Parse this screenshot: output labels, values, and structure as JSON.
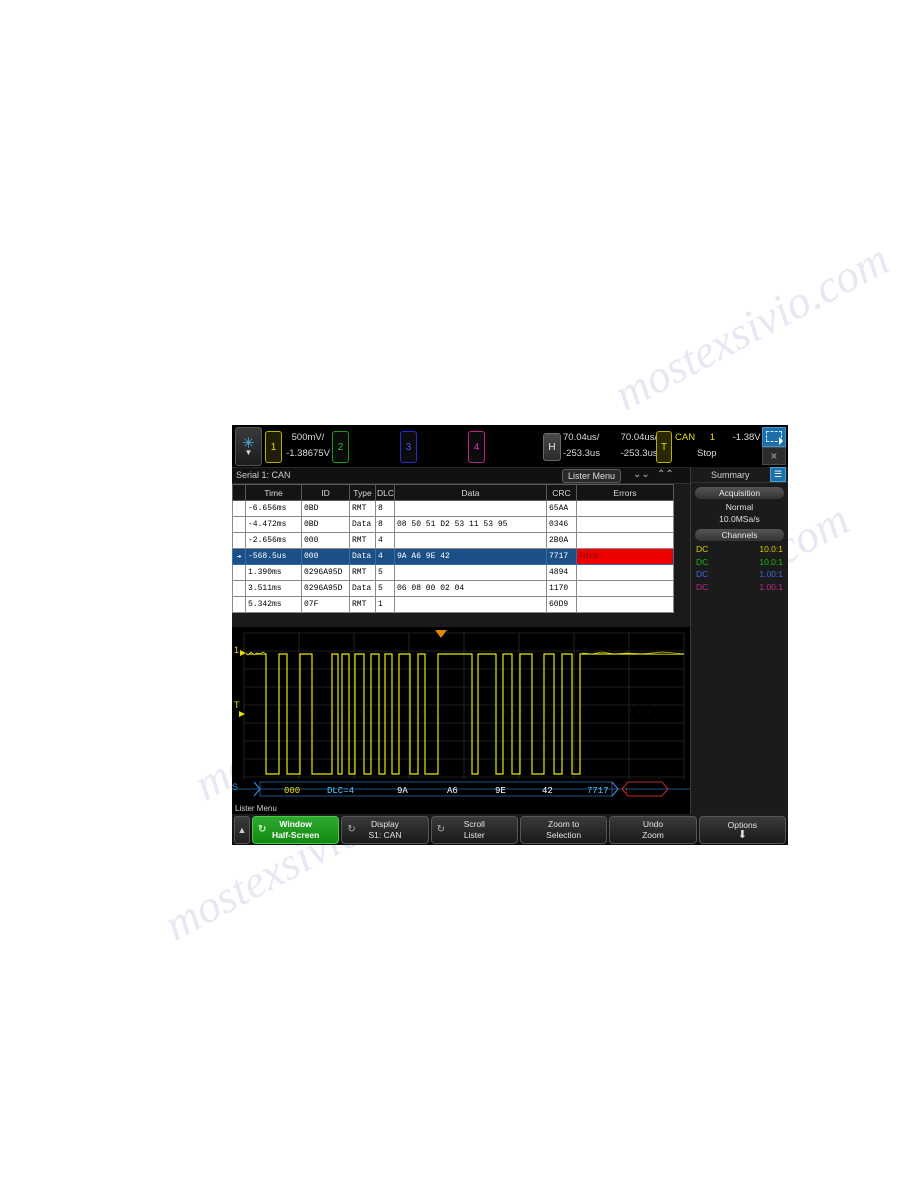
{
  "statusbar": {
    "logo_icon": "snowflake-icon",
    "logo_chevron": "▼",
    "channels": [
      {
        "num": "1",
        "color": "#e8de00"
      },
      {
        "num": "2",
        "color": "#22c322"
      },
      {
        "num": "3",
        "color": "#5555ff"
      },
      {
        "num": "4",
        "color": "#e030a8"
      }
    ],
    "ch1_scale": "500mV/",
    "ch1_offset": "-1.38675V",
    "horiz_label": "H",
    "horiz_scale": "70.04us/",
    "horiz_delay": "-253.3us",
    "horiz_scale2": "70.04us/",
    "horiz_delay2": "-253.3us",
    "trigger_label": "T",
    "trigger_type": "CAN",
    "trigger_source": "1",
    "trigger_level": "-1.38V",
    "run_state": "Stop",
    "select_icon": "selection-rectangle-icon",
    "wave_icon": "waveform-icon"
  },
  "lister": {
    "title": "Serial 1: CAN",
    "menu_button": "Lister Menu",
    "scroll_down_icon": "double-chevron-down-icon",
    "scroll_up_icon": "double-chevron-up-icon",
    "columns": [
      "",
      "Time",
      "ID",
      "Type",
      "DLC",
      "Data",
      "CRC",
      "Errors"
    ],
    "rows": [
      {
        "marker": "",
        "time": "-6.656ms",
        "id": "0BD",
        "type": "RMT",
        "dlc": "8",
        "data": "",
        "crc": "65AA",
        "errors": "",
        "selected": false
      },
      {
        "marker": "",
        "time": "-4.472ms",
        "id": "0BD",
        "type": "Data",
        "dlc": "8",
        "data": "08 50 51 D2 53 11 53 95",
        "crc": "0346",
        "errors": "",
        "selected": false
      },
      {
        "marker": "",
        "time": "-2.656ms",
        "id": "000",
        "type": "RMT",
        "dlc": "4",
        "data": "",
        "crc": "2B0A",
        "errors": "",
        "selected": false
      },
      {
        "marker": "➔",
        "time": "-568.5us",
        "id": "000",
        "type": "Data",
        "dlc": "4",
        "data": "9A A6 9E 42",
        "crc": "7717",
        "errors": "Form",
        "selected": true
      },
      {
        "marker": "",
        "time": "1.390ms",
        "id": "0296A95D",
        "type": "RMT",
        "dlc": "5",
        "data": "",
        "crc": "4894",
        "errors": "",
        "selected": false
      },
      {
        "marker": "",
        "time": "3.511ms",
        "id": "0296A95D",
        "type": "Data",
        "dlc": "5",
        "data": "06 08 00 02 04",
        "crc": "1170",
        "errors": "",
        "selected": false
      },
      {
        "marker": "",
        "time": "5.342ms",
        "id": "07F",
        "type": "RMT",
        "dlc": "1",
        "data": "",
        "crc": "60D9",
        "errors": "",
        "selected": false
      }
    ],
    "scroll_up_arrow": "▲",
    "scroll_down_arrow": "▼"
  },
  "sidebar": {
    "title": "Summary",
    "panel_icon": "list-panel-icon",
    "acquisition_label": "Acquisition",
    "acq_mode": "Normal",
    "acq_rate": "10.0MSa/s",
    "channels_label": "Channels",
    "channel_rows": [
      {
        "coupling": "DC",
        "ratio": "10.0:1",
        "color": "#d8d000"
      },
      {
        "coupling": "DC",
        "ratio": "10.0:1",
        "color": "#18b818"
      },
      {
        "coupling": "DC",
        "ratio": "1.00:1",
        "color": "#3a6ade"
      },
      {
        "coupling": "DC",
        "ratio": "1.00:1",
        "color": "#c02888"
      }
    ]
  },
  "waveform": {
    "ch1_marker": "1",
    "trigger_marker": "T",
    "serial_marker": "S",
    "decode_segments": [
      {
        "text": "000",
        "color": "#e8de00"
      },
      {
        "text": "DLC=4",
        "color": "#55c8ff"
      },
      {
        "text": "9A",
        "color": "#ffffff"
      },
      {
        "text": "A6",
        "color": "#ffffff"
      },
      {
        "text": "9E",
        "color": "#ffffff"
      },
      {
        "text": "42",
        "color": "#ffffff"
      },
      {
        "text": "7717",
        "color": "#55c8ff"
      }
    ]
  },
  "softkeys": {
    "menu_title": "Lister Menu",
    "back_icon": "▲",
    "keys": [
      {
        "line1": "Window",
        "line2": "Half-Screen",
        "icon": "rotary-knob-icon",
        "active": true
      },
      {
        "line1": "Display",
        "line2": "S1: CAN",
        "icon": "rotary-knob-icon",
        "active": false
      },
      {
        "line1": "Scroll",
        "line2": "Lister",
        "icon": "rotary-knob-icon",
        "active": false
      },
      {
        "line1": "Zoom to",
        "line2": "Selection",
        "icon": "",
        "active": false
      },
      {
        "line1": "Undo",
        "line2": "Zoom",
        "icon": "",
        "active": false
      },
      {
        "line1": "Options",
        "line2": "⬇",
        "icon": "",
        "active": false
      }
    ]
  },
  "watermark": {
    "l1": "mostexsivio.com",
    "l2": "mostexsivio.com",
    "l3": "mostexsivio.com",
    "l4": "mostexsivio.com"
  }
}
